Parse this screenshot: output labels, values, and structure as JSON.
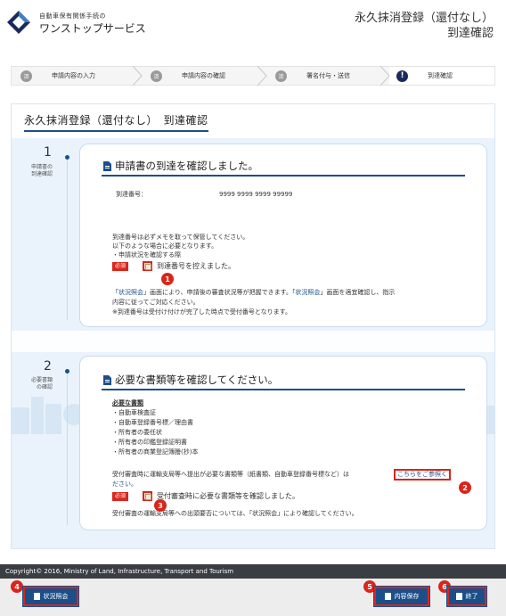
{
  "header": {
    "logo_sub": "自動車保有関係手続の",
    "logo_main": "ワンストップサービス",
    "title_line1": "永久抹消登録（還付なし）",
    "title_line2": "到達確認"
  },
  "stepper": {
    "steps": [
      {
        "icon": "済",
        "label": "申請内容の入力"
      },
      {
        "icon": "済",
        "label": "申請内容の確認"
      },
      {
        "icon": "済",
        "label": "署名付与・送信"
      },
      {
        "icon": "!",
        "label": "到達確認"
      }
    ]
  },
  "page_title": "永久抹消登録（還付なし）　到達確認",
  "section1": {
    "number": "1",
    "label_line1": "申請書の",
    "label_line2": "到達確認",
    "title": "申請書の到達を確認しました。",
    "arrival_label": "到達番号：",
    "arrival_value": "9999 9999 9999 99999",
    "note1": "到達番号は必ずメモを取って保管してください。",
    "note2": "以下のような場合に必要となります。",
    "note3": "・申請状況を確認する際",
    "required_badge": "必須",
    "check_label": "到達番号を控えました。",
    "info1_a": "「",
    "info1_link1": "状況照会",
    "info1_b": "」画面により、申請後の審査状況等が把握できます。「",
    "info1_link2": "状況照会",
    "info1_c": "」画面を適宜確認し、指示",
    "info2": "内容に従ってご対応ください。",
    "info3": "※到達番号は受付け付けが完了した時点で受付番号となります。"
  },
  "section2": {
    "number": "2",
    "label_line1": "必要書類",
    "label_line2": "の確認",
    "title": "必要な書類等を確認してください。",
    "docs_heading": "必要な書類",
    "docs": [
      "・自動車検査証",
      "・自動車登録番号標／理由書",
      "・所有者の委任状",
      "・所有者の印鑑登録証明書",
      "・所有者の商業登記簿謄(抄)本"
    ],
    "contact_note": "受付審査時に運輸支局等へ提出が必要な書類等（紙書類、自動車登録番号標など）は",
    "contact_link": "こちらをご参照く",
    "contact_note2": "ださい。",
    "required_badge": "必須",
    "check_label": "受付審査時に必要な書類等を確認しました。",
    "footer_note": "受付審査の運輸支局等への出頭要否については、「状況照会」により確認してください。"
  },
  "markers": [
    "1",
    "2",
    "3",
    "4",
    "5",
    "6"
  ],
  "copyright": "Copyright© 2016, Ministry of Land, Infrastructure, Transport and Tourism",
  "footer": {
    "status_button": "状況照会",
    "save_button": "内容保存",
    "end_button": "終了"
  },
  "colors": {
    "brand": "#1b4f8a",
    "accent_red": "#d9261c",
    "panel_bg": "#eaf3fb"
  }
}
